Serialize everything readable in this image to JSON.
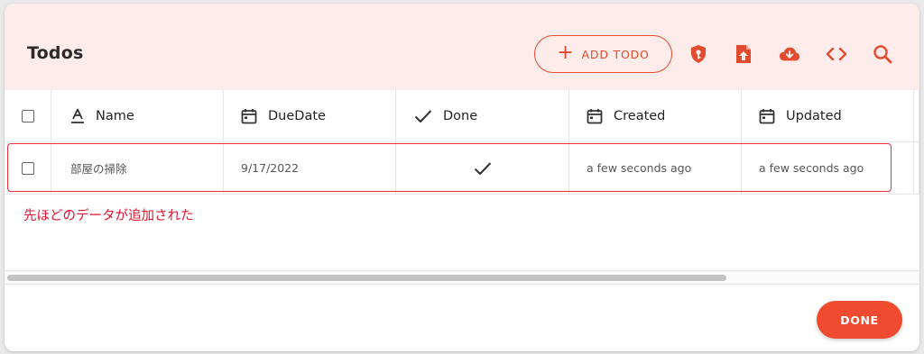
{
  "dialog": {
    "title": "Todos",
    "add_button_label": "ADD TODO",
    "done_button_label": "DONE",
    "accent_color": "#f04a2f",
    "header_bg": "#fdecea"
  },
  "header_icons": [
    "shield-key-icon",
    "file-upload-icon",
    "cloud-download-icon",
    "code-icon",
    "search-icon"
  ],
  "table": {
    "columns": [
      {
        "label": "Name",
        "icon": "text-format-icon"
      },
      {
        "label": "DueDate",
        "icon": "calendar-icon"
      },
      {
        "label": "Done",
        "icon": "check-icon"
      },
      {
        "label": "Created",
        "icon": "calendar-icon"
      },
      {
        "label": "Updated",
        "icon": "calendar-icon"
      }
    ],
    "rows": [
      {
        "name": "部屋の掃除",
        "due_date": "9/17/2022",
        "done": true,
        "created": "a few seconds ago",
        "updated": "a few seconds ago"
      }
    ]
  },
  "annotation": {
    "text": "先ほどのデータが追加された",
    "color": "#e8102c"
  }
}
